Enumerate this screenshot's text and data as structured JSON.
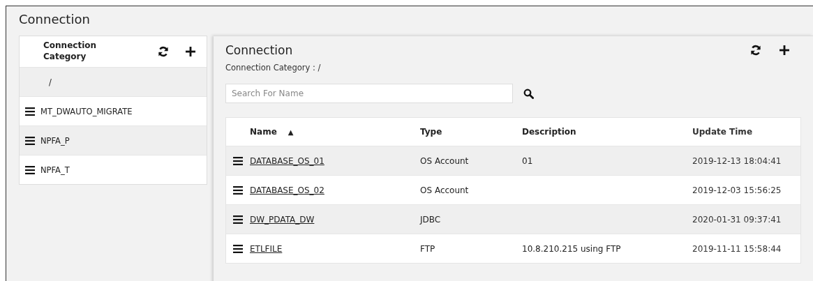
{
  "page": {
    "title": "Connection"
  },
  "sidebar": {
    "heading": "Connection Category",
    "items": [
      {
        "label": "/",
        "has_menu": false,
        "selected": true
      },
      {
        "label": "MT_DWAUTO_MIGRATE",
        "has_menu": true,
        "selected": false
      },
      {
        "label": "NPFA_P",
        "has_menu": true,
        "selected": true
      },
      {
        "label": "NPFA_T",
        "has_menu": true,
        "selected": false
      }
    ]
  },
  "main": {
    "title": "Connection",
    "breadcrumb": "Connection Category : /",
    "search": {
      "placeholder": "Search For Name"
    },
    "table": {
      "columns": [
        {
          "label": "Name",
          "sort": "▲"
        },
        {
          "label": "Type"
        },
        {
          "label": "Description"
        },
        {
          "label": "Update Time"
        }
      ],
      "rows": [
        {
          "name": "DATABASE_OS_01",
          "type": "OS Account",
          "description": "01",
          "update_time": "2019-12-13 18:04:41"
        },
        {
          "name": "DATABASE_OS_02",
          "type": "OS Account",
          "description": "",
          "update_time": "2019-12-03 15:56:25"
        },
        {
          "name": "DW_PDATA_DW",
          "type": "JDBC",
          "description": "",
          "update_time": "2020-01-31 09:37:41"
        },
        {
          "name": "ETLFILE",
          "type": "FTP",
          "description": "10.8.210.215 using FTP",
          "update_time": "2019-11-11 15:58:44"
        }
      ]
    }
  }
}
